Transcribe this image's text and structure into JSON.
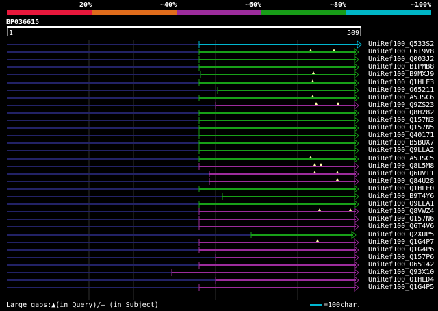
{
  "coverage_legend": [
    {
      "label": "20%",
      "color": "#e8183c"
    },
    {
      "label": "~40%",
      "color": "#e06c1c"
    },
    {
      "label": "~60%",
      "color": "#9c2c9c"
    },
    {
      "label": "~80%",
      "color": "#189c18"
    },
    {
      "label": "~100%",
      "color": "#00b6c6"
    }
  ],
  "query": {
    "id": "BP036615",
    "start": "1",
    "end": "509"
  },
  "colors": {
    "blue": "#00b6d0",
    "green": "#18a018",
    "purple": "#9c2c9c",
    "dashed": "#222266",
    "vline": "#303030",
    "gap": "#ffffaa"
  },
  "hits": [
    {
      "name": "UniRef100_Q533S2",
      "color": "blue",
      "start": 291,
      "end": 526,
      "gaps": []
    },
    {
      "name": "UniRef100_C6T9V8",
      "color": "green",
      "start": 291,
      "end": 522,
      "gaps": [
        454,
        488
      ]
    },
    {
      "name": "UniRef100_Q003J2",
      "color": "green",
      "start": 291,
      "end": 522,
      "gaps": []
    },
    {
      "name": "UniRef100_B1PMB8",
      "color": "green",
      "start": 291,
      "end": 522,
      "gaps": []
    },
    {
      "name": "UniRef100_B9MXJ9",
      "color": "green",
      "start": 293,
      "end": 522,
      "gaps": [
        458
      ]
    },
    {
      "name": "UniRef100_Q1HLE3",
      "color": "green",
      "start": 291,
      "end": 522,
      "gaps": [
        457
      ]
    },
    {
      "name": "UniRef100_O65211",
      "color": "green",
      "start": 318,
      "end": 522,
      "gaps": []
    },
    {
      "name": "UniRef100_A5JSC6",
      "color": "green",
      "start": 291,
      "end": 522,
      "gaps": [
        457
      ]
    },
    {
      "name": "UniRef100_Q9ZS23",
      "color": "purple",
      "start": 315,
      "end": 522,
      "gaps": [
        462,
        494
      ]
    },
    {
      "name": "UniRef100_Q8H282",
      "color": "green",
      "start": 291,
      "end": 522,
      "gaps": []
    },
    {
      "name": "UniRef100_Q157N3",
      "color": "green",
      "start": 291,
      "end": 522,
      "gaps": []
    },
    {
      "name": "UniRef100_Q157N5",
      "color": "green",
      "start": 291,
      "end": 522,
      "gaps": []
    },
    {
      "name": "UniRef100_Q40171",
      "color": "green",
      "start": 291,
      "end": 522,
      "gaps": []
    },
    {
      "name": "UniRef100_B5BUX7",
      "color": "green",
      "start": 291,
      "end": 522,
      "gaps": []
    },
    {
      "name": "UniRef100_Q9LLA2",
      "color": "green",
      "start": 291,
      "end": 522,
      "gaps": []
    },
    {
      "name": "UniRef100_A5JSC5",
      "color": "green",
      "start": 291,
      "end": 522,
      "gaps": [
        454
      ]
    },
    {
      "name": "UniRef100_Q8L5M8",
      "color": "purple",
      "start": 291,
      "end": 522,
      "gaps": [
        460,
        469
      ]
    },
    {
      "name": "UniRef100_Q6UVI1",
      "color": "purple",
      "start": 306,
      "end": 522,
      "gaps": [
        460,
        493
      ]
    },
    {
      "name": "UniRef100_Q84U28",
      "color": "purple",
      "start": 306,
      "end": 522,
      "gaps": [
        493
      ]
    },
    {
      "name": "UniRef100_Q1HLE0",
      "color": "green",
      "start": 291,
      "end": 522,
      "gaps": []
    },
    {
      "name": "UniRef100_B9T4Y6",
      "color": "green",
      "start": 325,
      "end": 522,
      "gaps": []
    },
    {
      "name": "UniRef100_Q9LLA1",
      "color": "green",
      "start": 291,
      "end": 522,
      "gaps": []
    },
    {
      "name": "UniRef100_Q8VWZ4",
      "color": "purple",
      "start": 291,
      "end": 522,
      "gaps": [
        467,
        512
      ]
    },
    {
      "name": "UniRef100_Q157N6",
      "color": "purple",
      "start": 291,
      "end": 522,
      "gaps": []
    },
    {
      "name": "UniRef100_Q6T4V6",
      "color": "purple",
      "start": 291,
      "end": 522,
      "gaps": []
    },
    {
      "name": "UniRef100_Q2XUP5",
      "color": "green",
      "start": 367,
      "end": 518,
      "gaps": []
    },
    {
      "name": "UniRef100_Q1G4P7",
      "color": "purple",
      "start": 291,
      "end": 522,
      "gaps": [
        464
      ]
    },
    {
      "name": "UniRef100_Q1G4P6",
      "color": "purple",
      "start": 291,
      "end": 522,
      "gaps": []
    },
    {
      "name": "UniRef100_Q157P6",
      "color": "purple",
      "start": 315,
      "end": 522,
      "gaps": []
    },
    {
      "name": "UniRef100_O65142",
      "color": "purple",
      "start": 291,
      "end": 522,
      "gaps": []
    },
    {
      "name": "UniRef100_Q93X10",
      "color": "purple",
      "start": 251,
      "end": 522,
      "gaps": []
    },
    {
      "name": "UniRef100_Q1HLD4",
      "color": "purple",
      "start": 315,
      "end": 522,
      "gaps": []
    },
    {
      "name": "UniRef100_Q1G4P5",
      "color": "purple",
      "start": 291,
      "end": 522,
      "gaps": []
    }
  ],
  "footer": {
    "text": "Large gaps:▲(in Query)/– (in Subject)",
    "scale": "=100char."
  }
}
